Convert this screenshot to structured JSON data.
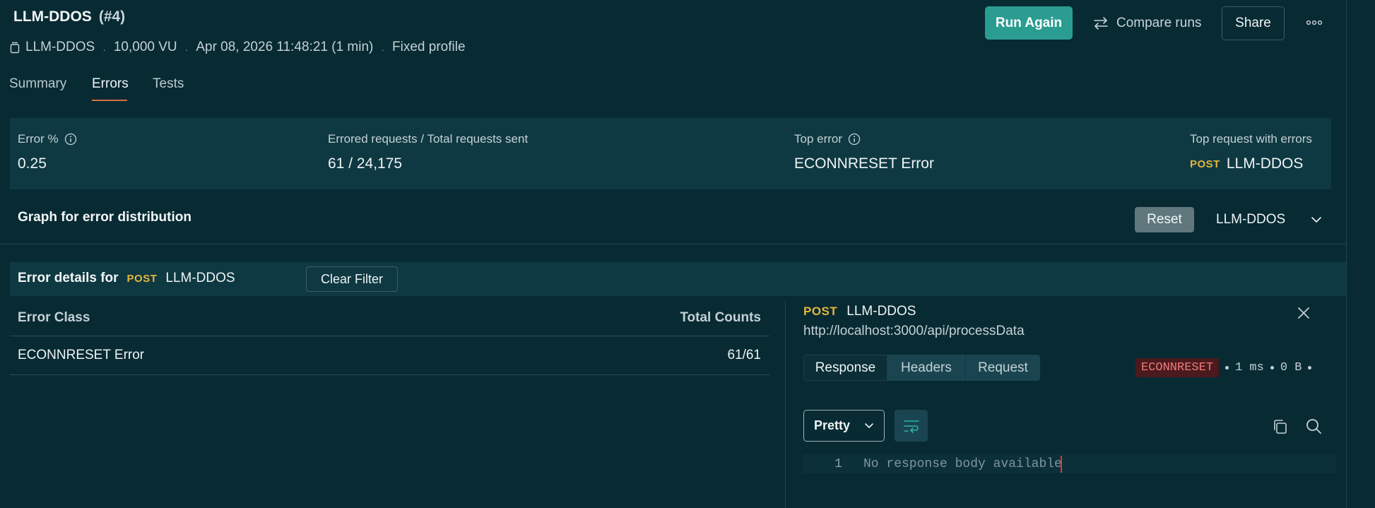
{
  "header": {
    "title": "LLM-DDOS",
    "run_number": "(#4)",
    "meta": {
      "collection": "LLM-DDOS",
      "vu": "10,000 VU",
      "datetime": "Apr 08, 2026 11:48:21 (1 min)",
      "profile": "Fixed profile"
    },
    "run_again_label": "Run Again",
    "compare_label": "Compare runs",
    "share_label": "Share"
  },
  "tabs": [
    {
      "label": "Summary",
      "active": false
    },
    {
      "label": "Errors",
      "active": true
    },
    {
      "label": "Tests",
      "active": false
    }
  ],
  "stats": {
    "error_pct_label": "Error %",
    "error_pct_value": "0.25",
    "errored_label": "Errored requests / Total requests sent",
    "errored_value": "61 / 24,175",
    "top_error_label": "Top error",
    "top_error_value": "ECONNRESET Error",
    "top_request_label": "Top request with errors",
    "top_request_method": "POST",
    "top_request_name": "LLM-DDOS"
  },
  "graph": {
    "title": "Graph for error distribution",
    "reset_label": "Reset",
    "selected_request": "LLM-DDOS"
  },
  "details": {
    "label": "Error details for",
    "method": "POST",
    "request": "LLM-DDOS",
    "clear_label": "Clear Filter"
  },
  "table": {
    "headers": [
      "Error Class",
      "Total Counts"
    ],
    "rows": [
      {
        "error_class": "ECONNRESET Error",
        "count": "61/61"
      }
    ]
  },
  "request_pane": {
    "method": "POST",
    "name": "LLM-DDOS",
    "url": "http://localhost:3000/api/processData",
    "tabs": [
      "Response",
      "Headers",
      "Request"
    ],
    "active_tab": "Response",
    "status_code": "ECONNRESET",
    "time": "1 ms",
    "size": "0 B",
    "format": "Pretty",
    "line_number": "1",
    "body_text": "No response body available"
  },
  "colors": {
    "background": "#082a33",
    "panel": "#0f3942",
    "primary": "#2a9d90",
    "method_post": "#e3b63d",
    "tab_underline": "#d66e45",
    "error_badge": "#f07a7a"
  }
}
